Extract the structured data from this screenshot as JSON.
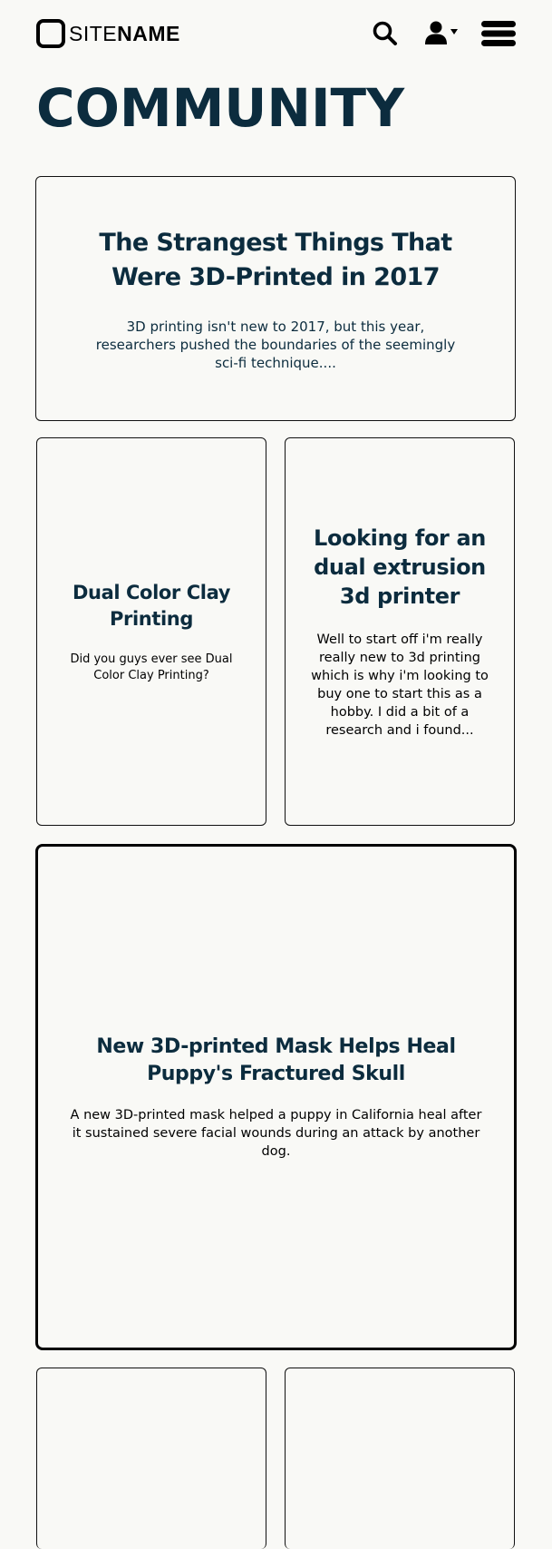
{
  "site": {
    "name_light": "SITE",
    "name_bold": "NAME"
  },
  "header": {
    "icons": [
      "search-icon",
      "user-icon",
      "chevron-down-icon",
      "menu-icon"
    ]
  },
  "page": {
    "title": "COMMUNITY"
  },
  "cards": [
    {
      "title": "The Strangest Things That Were 3D-Printed in 2017",
      "excerpt": "3D printing isn't new to 2017, but this year, researchers pushed the boundaries of the seemingly sci-fi technique...."
    },
    {
      "title": "Dual Color Clay Printing",
      "excerpt": "Did you guys ever see Dual Color Clay Printing?"
    },
    {
      "title": "Looking for an dual extrusion 3d printer",
      "excerpt": "Well to start off i'm really really new to 3d printing which is why i'm looking to buy one to start this as a hobby. I did a bit of a research and i found..."
    },
    {
      "title": "New 3D-printed Mask Helps Heal Puppy's Fractured Skull",
      "excerpt": "A new 3D-printed mask helped a puppy in California heal after it sustained severe facial wounds during an attack by another dog."
    }
  ],
  "colors": {
    "background": "#f9f9f6",
    "heading": "#0c2c3e",
    "border": "#111111"
  }
}
